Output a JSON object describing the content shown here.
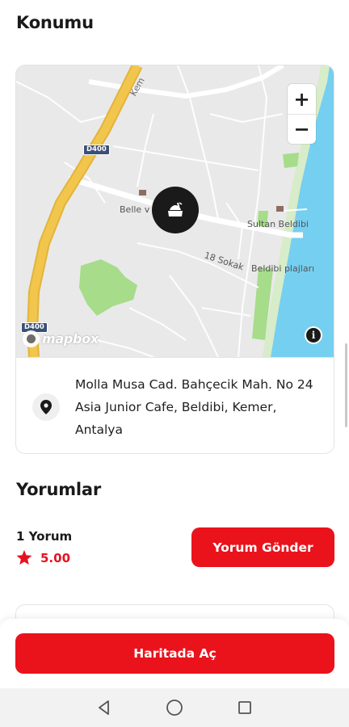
{
  "location": {
    "title": "Konumu",
    "map": {
      "zoom_in": "+",
      "zoom_out": "−",
      "labels": {
        "road_kem": "Kem",
        "belle": "Belle v",
        "sultan": "Sultan Beldibi",
        "sokak": "18 Sokak",
        "plajlari": "Beldibi plajları",
        "shield_top": "D400",
        "shield_bottom": "D400"
      },
      "attribution_logo": "mapbox",
      "info_label": "i"
    },
    "address": "Molla Musa Cad. Bahçecik Mah. No 24 Asia Junior Cafe, Beldibi, Kemer, Antalya"
  },
  "reviews": {
    "title": "Yorumlar",
    "count_label": "1 Yorum",
    "rating": "5.00",
    "send_button": "Yorum Gönder"
  },
  "actions": {
    "open_map_button": "Haritada Aç"
  },
  "colors": {
    "accent": "#ea131c",
    "sea": "#75cff0",
    "highway": "#f2c64d",
    "park": "#a6dc8a",
    "land": "#e8e8e8"
  }
}
